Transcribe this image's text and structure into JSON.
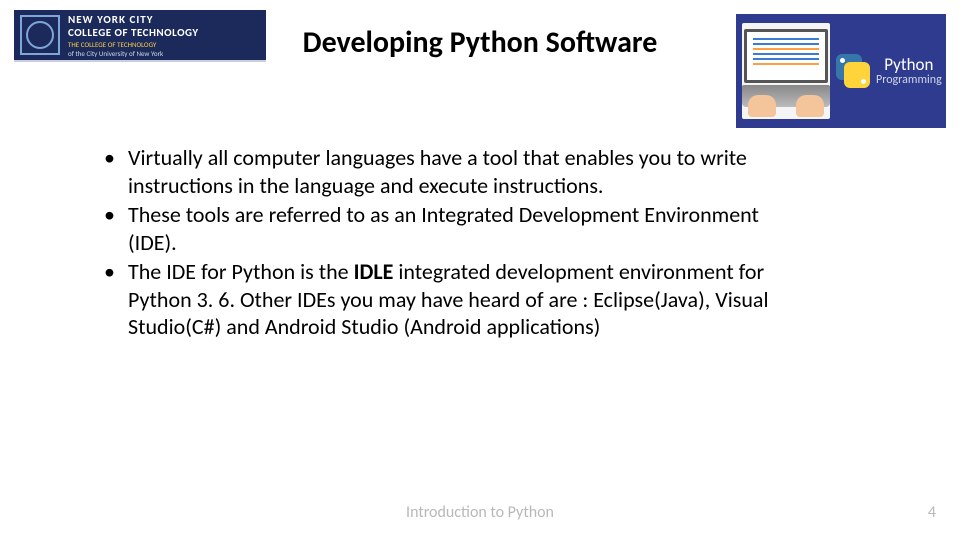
{
  "logo": {
    "line1": "NEW YORK CITY",
    "line2": "COLLEGE OF TECHNOLOGY",
    "line3": "THE COLLEGE OF TECHNOLOGY",
    "line4": "of the City University of New York"
  },
  "title": "Developing Python Software",
  "promo": {
    "brand": "Python",
    "sub": "Programming"
  },
  "bullets": [
    {
      "text": "Virtually all computer languages have a tool that enables you to write instructions in the language and execute instructions."
    },
    {
      "text": "These tools are referred to as an Integrated Development Environment (IDE)."
    },
    {
      "pre": "The IDE for Python is the ",
      "bold": "IDLE",
      "post": " integrated development environment for Python 3. 6. Other IDEs you may have heard of are :  Eclipse(Java), Visual Studio(C#) and Android Studio (Android applications)"
    }
  ],
  "footer": {
    "center": "Introduction to Python",
    "page": "4"
  }
}
